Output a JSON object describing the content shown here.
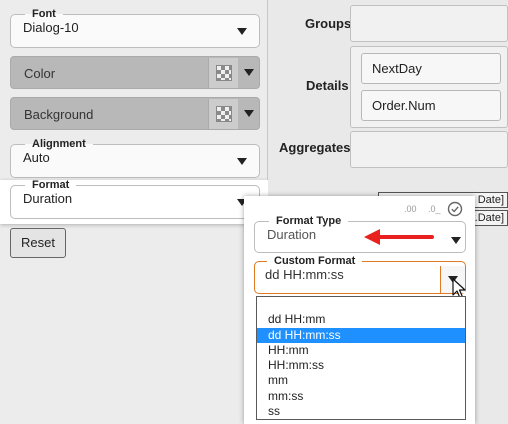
{
  "left_panel": {
    "font": {
      "legend": "Font",
      "value": "Dialog-10"
    },
    "color": {
      "label": "Color"
    },
    "background": {
      "label": "Background"
    },
    "alignment": {
      "legend": "Alignment",
      "value": "Auto"
    },
    "format": {
      "legend": "Format",
      "value": "Duration"
    },
    "reset_label": "Reset"
  },
  "right_panel": {
    "groups_label": "Groups",
    "details_label": "Details",
    "details_items": [
      "NextDay",
      "Order.Num"
    ],
    "aggregates_label": "Aggregates",
    "hidden_cells": [
      "Date]",
      "r.Date]"
    ]
  },
  "format_popup": {
    "toolbar": [
      ".00",
      ".0_"
    ],
    "format_type": {
      "legend": "Format Type",
      "value": "Duration"
    },
    "custom_format": {
      "legend": "Custom Format",
      "value": "dd HH:mm:ss"
    },
    "options": [
      "",
      "dd HH:mm",
      "dd HH:mm:ss",
      "HH:mm",
      "HH:mm:ss",
      "mm",
      "mm:ss",
      "ss"
    ],
    "selected_index": 2
  },
  "colors": {
    "selection": "#1e90ff",
    "annotation_arrow": "#e8201e",
    "custom_format_border": "#e07a22"
  }
}
